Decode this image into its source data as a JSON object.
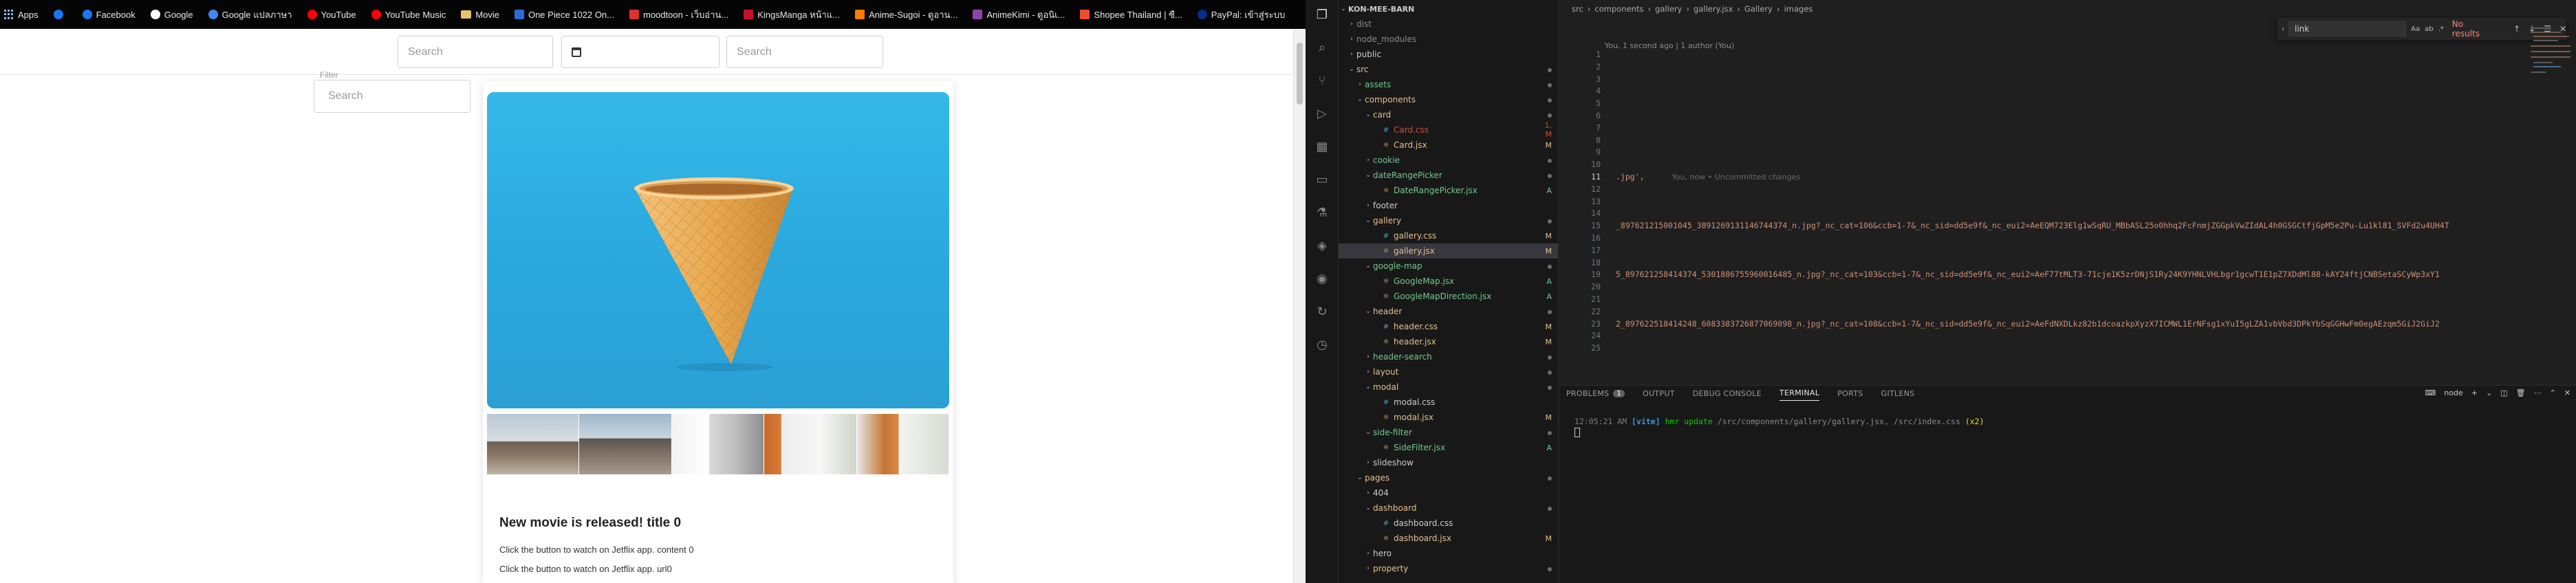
{
  "bookmarks": [
    {
      "label": "Apps",
      "icon": "apps-grid-icon",
      "color": "#8ab4f8"
    },
    {
      "label": "",
      "icon": "facebook-icon",
      "color": "#1877f2"
    },
    {
      "label": "Facebook",
      "icon": "facebook-icon",
      "color": "#1877f2"
    },
    {
      "label": "Google",
      "icon": "google-icon",
      "color": "#ffffff"
    },
    {
      "label": "Google แปลภาษา",
      "icon": "google-translate-icon",
      "color": "#4285f4"
    },
    {
      "label": "YouTube",
      "icon": "youtube-icon",
      "color": "#ff0000"
    },
    {
      "label": "YouTube Music",
      "icon": "youtube-music-icon",
      "color": "#ff0000"
    },
    {
      "label": "Movie",
      "icon": "folder-icon",
      "color": "#e6c46a"
    },
    {
      "label": "One Piece 1022 On...",
      "icon": "site-icon",
      "color": "#2b6bd6"
    },
    {
      "label": "moodtoon - เว็บอ่าน...",
      "icon": "site-icon",
      "color": "#e03030"
    },
    {
      "label": "KingsManga หน้าแ...",
      "icon": "site-icon",
      "color": "#c8102e"
    },
    {
      "label": "Anime-Sugoi - ดูอาน...",
      "icon": "site-icon",
      "color": "#ff7a00"
    },
    {
      "label": "AnimeKimi - ดูอนิเ...",
      "icon": "site-icon",
      "color": "#8e44ad"
    },
    {
      "label": "Shopee Thailand | ซื...",
      "icon": "site-icon",
      "color": "#ee4d2d"
    },
    {
      "label": "PayPal: เข้าสู่ระบบ",
      "icon": "paypal-icon",
      "color": "#003087"
    }
  ],
  "header": {
    "search1_placeholder": "Search",
    "search2_placeholder": "Search"
  },
  "sidebar": {
    "label": "Filter",
    "search_placeholder": "Search"
  },
  "card": {
    "title": "New movie is released! title 0",
    "line1": "Click the button to watch on Jetflix app. content 0",
    "line2": "Click the button to watch on Jetflix app. url0"
  },
  "explorer": {
    "root": "KON-MEE-BARN",
    "items": [
      {
        "label": "dist",
        "depth": 1,
        "type": "folder",
        "open": false,
        "status": "ign",
        "badge": ""
      },
      {
        "label": "node_modules",
        "depth": 1,
        "type": "folder",
        "open": false,
        "status": "ign",
        "badge": ""
      },
      {
        "label": "public",
        "depth": 1,
        "type": "folder",
        "open": false,
        "status": "root",
        "badge": ""
      },
      {
        "label": "src",
        "depth": 1,
        "type": "folder",
        "open": true,
        "status": "mod",
        "badge": "dot"
      },
      {
        "label": "assets",
        "depth": 2,
        "type": "folder",
        "open": false,
        "status": "add",
        "badge": "dot"
      },
      {
        "label": "components",
        "depth": 2,
        "type": "folder",
        "open": true,
        "status": "mod",
        "badge": "dot"
      },
      {
        "label": "card",
        "depth": 3,
        "type": "folder",
        "open": true,
        "status": "mod",
        "badge": "dot"
      },
      {
        "label": "Card.css",
        "depth": 4,
        "type": "css",
        "status": "err",
        "badge": "1, M"
      },
      {
        "label": "Card.jsx",
        "depth": 4,
        "type": "jsx",
        "status": "mod",
        "badge": "M"
      },
      {
        "label": "cookie",
        "depth": 3,
        "type": "folder",
        "open": false,
        "status": "add",
        "badge": "dot"
      },
      {
        "label": "dateRangePicker",
        "depth": 3,
        "type": "folder",
        "open": true,
        "status": "add",
        "badge": "dot"
      },
      {
        "label": "DateRangePicker.jsx",
        "depth": 4,
        "type": "jsx",
        "status": "add",
        "badge": "A"
      },
      {
        "label": "footer",
        "depth": 3,
        "type": "folder",
        "open": false,
        "status": "root",
        "badge": ""
      },
      {
        "label": "gallery",
        "depth": 3,
        "type": "folder",
        "open": true,
        "status": "mod",
        "badge": "dot"
      },
      {
        "label": "gallery.css",
        "depth": 4,
        "type": "css",
        "status": "mod",
        "badge": "M"
      },
      {
        "label": "gallery.jsx",
        "depth": 4,
        "type": "jsx",
        "status": "mod",
        "badge": "M",
        "selected": true
      },
      {
        "label": "google-map",
        "depth": 3,
        "type": "folder",
        "open": true,
        "status": "add",
        "badge": "dot"
      },
      {
        "label": "GoogleMap.jsx",
        "depth": 4,
        "type": "jsx",
        "status": "add",
        "badge": "A"
      },
      {
        "label": "GoogleMapDirection.jsx",
        "depth": 4,
        "type": "jsx",
        "status": "add",
        "badge": "A"
      },
      {
        "label": "header",
        "depth": 3,
        "type": "folder",
        "open": true,
        "status": "mod",
        "badge": "dot"
      },
      {
        "label": "header.css",
        "depth": 4,
        "type": "css",
        "status": "mod",
        "badge": "M"
      },
      {
        "label": "header.jsx",
        "depth": 4,
        "type": "jsx",
        "status": "mod",
        "badge": "M"
      },
      {
        "label": "header-search",
        "depth": 3,
        "type": "folder",
        "open": false,
        "status": "add",
        "badge": "dot"
      },
      {
        "label": "layout",
        "depth": 3,
        "type": "folder",
        "open": false,
        "status": "mod",
        "badge": "dot"
      },
      {
        "label": "modal",
        "depth": 3,
        "type": "folder",
        "open": true,
        "status": "mod",
        "badge": "dot"
      },
      {
        "label": "modal.css",
        "depth": 4,
        "type": "css",
        "status": "root",
        "badge": ""
      },
      {
        "label": "modal.jsx",
        "depth": 4,
        "type": "jsx",
        "status": "mod",
        "badge": "M"
      },
      {
        "label": "side-filter",
        "depth": 3,
        "type": "folder",
        "open": true,
        "status": "add",
        "badge": "dot"
      },
      {
        "label": "SideFilter.jsx",
        "depth": 4,
        "type": "jsx",
        "status": "add",
        "badge": "A"
      },
      {
        "label": "slideshow",
        "depth": 3,
        "type": "folder",
        "open": false,
        "status": "root",
        "badge": ""
      },
      {
        "label": "pages",
        "depth": 2,
        "type": "folder",
        "open": true,
        "status": "mod",
        "badge": "dot"
      },
      {
        "label": "404",
        "depth": 3,
        "type": "folder",
        "open": false,
        "status": "root",
        "badge": ""
      },
      {
        "label": "dashboard",
        "depth": 3,
        "type": "folder",
        "open": true,
        "status": "mod",
        "badge": "dot"
      },
      {
        "label": "dashboard.css",
        "depth": 4,
        "type": "css",
        "status": "root",
        "badge": ""
      },
      {
        "label": "dashboard.jsx",
        "depth": 4,
        "type": "jsx",
        "status": "mod",
        "badge": "M"
      },
      {
        "label": "hero",
        "depth": 3,
        "type": "folder",
        "open": false,
        "status": "root",
        "badge": ""
      },
      {
        "label": "property",
        "depth": 3,
        "type": "folder",
        "open": false,
        "status": "mod",
        "badge": "dot"
      }
    ]
  },
  "editor": {
    "breadcrumbs": [
      "src",
      "components",
      "gallery",
      "gallery.jsx",
      "Gallery",
      "images"
    ],
    "blame": "You, 1 second ago | 1 author (You)",
    "line_numbers": [
      "1",
      "2",
      "3",
      "4",
      "5",
      "6",
      "7",
      "8",
      "9",
      "10",
      "11",
      "12",
      "13",
      "14",
      "15",
      "16",
      "17",
      "18",
      "19",
      "20",
      "21",
      "22",
      "23",
      "24",
      "25"
    ],
    "current_line": "11",
    "code_lines": [
      {
        "line": "11",
        "text": ".jpg',",
        "annotation": "You, now • Uncommitted changes"
      },
      {
        "line": "15",
        "text": "_897621215001045_3891269131146744374_n.jpg?_nc_cat=106&ccb=1-7&_nc_sid=dd5e9f&_nc_eui2=AeEQM723Elg1wSqRU_MBbASL25o0hhq2FcFnmjZGGpkVwZIdAL4h0GSGCtfjGpM5e2Pu-Lu1kl81_SVFd2u4UH4T"
      },
      {
        "line": "19",
        "text": "5_897621258414374_5301886755960016485_n.jpg?_nc_cat=103&ccb=1-7&_nc_sid=dd5e9f&_nc_eui2=AeF77tMLT3-71cje1K5zrDNjS1Ry24K9YHNLVHLbgr1gcwT1E1pZ7XDdMl88-kAY24ftjCNBSetaSCyWp3xY1"
      },
      {
        "line": "23",
        "text": "2_897622518414248_6083383726877069098_n.jpg?_nc_cat=108&ccb=1-7&_nc_sid=dd5e9f&_nc_eui2=AeFdNXDLkz82b1dcoazkpXyzX7ICMWL1ErNFsg1xYuI5gLZA1vbVbd3DPkYbSqGGHwFm0egAEzqm5GiJ2GiJ2"
      }
    ],
    "find": {
      "query": "link",
      "status": "No results"
    }
  },
  "panel": {
    "tabs": [
      "PROBLEMS",
      "OUTPUT",
      "DEBUG CONSOLE",
      "TERMINAL",
      "PORTS",
      "GITLENS"
    ],
    "active_tab": "TERMINAL",
    "problems_count": "1",
    "terminal_label": "node",
    "terminal": {
      "time": "12:05:21 AM",
      "tag": "[vite]",
      "hmr": "hmr update",
      "paths": "/src/components/gallery/gallery.jsx, /src/index.css",
      "count": "(x2)"
    }
  }
}
